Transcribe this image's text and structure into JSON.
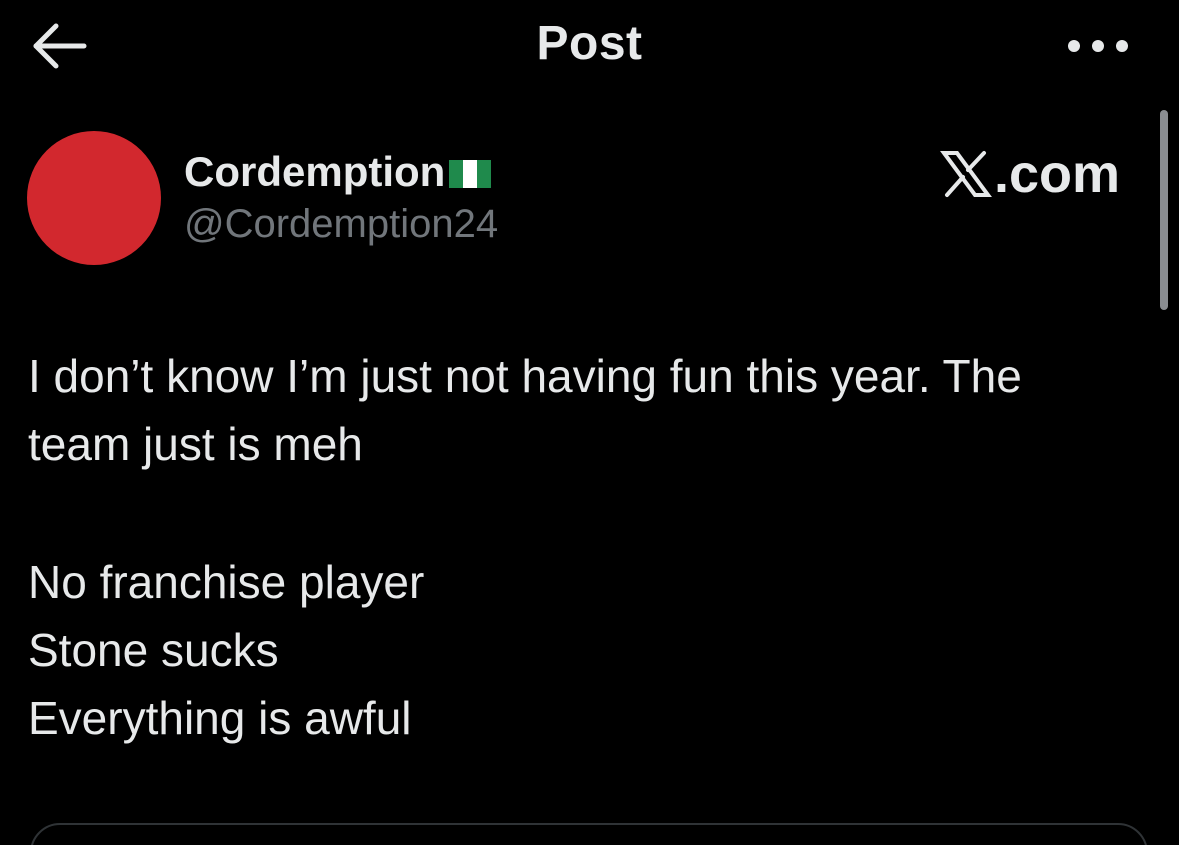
{
  "header": {
    "title": "Post",
    "back_icon": "arrow-left-icon",
    "more_icon": "more-horizontal-icon"
  },
  "post": {
    "author": {
      "display_name": "Cordemption",
      "flag_icon": "nigeria-flag-icon",
      "handle": "@Cordemption24",
      "avatar_color": "#d2282e"
    },
    "watermark": {
      "icon": "x-logo-icon",
      "text": ".com"
    },
    "paragraphs": {
      "line1": "I don’t know I’m just not having fun this year. The",
      "line2": "team just is meh",
      "line3": "No franchise player",
      "line4": "Stone sucks",
      "line5": "Everything is awful"
    }
  },
  "colors": {
    "background": "#000000",
    "text_primary": "#e7e9ea",
    "text_secondary": "#71767b",
    "border": "#2f3336"
  }
}
